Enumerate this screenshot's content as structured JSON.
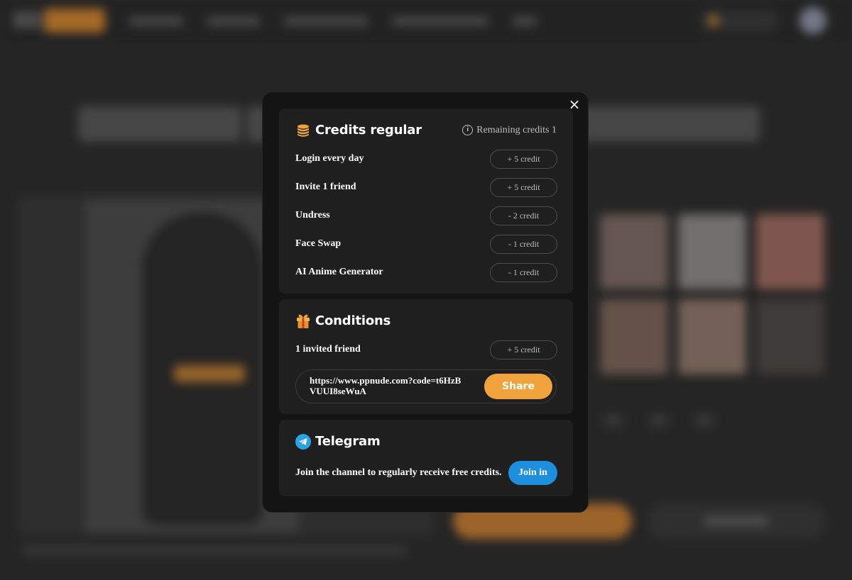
{
  "modal": {
    "close_label": "×",
    "credits": {
      "icon": "coins-icon",
      "title": "Credits regular",
      "remaining_label": "Remaining credits 1",
      "rows": [
        {
          "label": "Login every day",
          "value": "+ 5 credit"
        },
        {
          "label": "Invite 1 friend",
          "value": "+ 5 credit"
        },
        {
          "label": "Undress",
          "value": "- 2 credit"
        },
        {
          "label": "Face Swap",
          "value": "- 1 credit"
        },
        {
          "label": "AI Anime Generator",
          "value": "- 1 credit"
        }
      ]
    },
    "conditions": {
      "icon": "gift-icon",
      "title": "Conditions",
      "row": {
        "label": "1 invited friend",
        "value": "+ 5 credit"
      },
      "link": "https://www.ppnude.com?code=t6HzBVUUI8seWuA",
      "share_label": "Share"
    },
    "telegram": {
      "icon": "telegram-icon",
      "title": "Telegram",
      "text": "Join the channel to regularly receive free credits.",
      "join_label": "Join in"
    }
  },
  "colors": {
    "accent_orange": "#f0a23c",
    "telegram_blue": "#1d8fdc",
    "modal_bg": "#141414",
    "section_bg": "#1f1f1f"
  }
}
